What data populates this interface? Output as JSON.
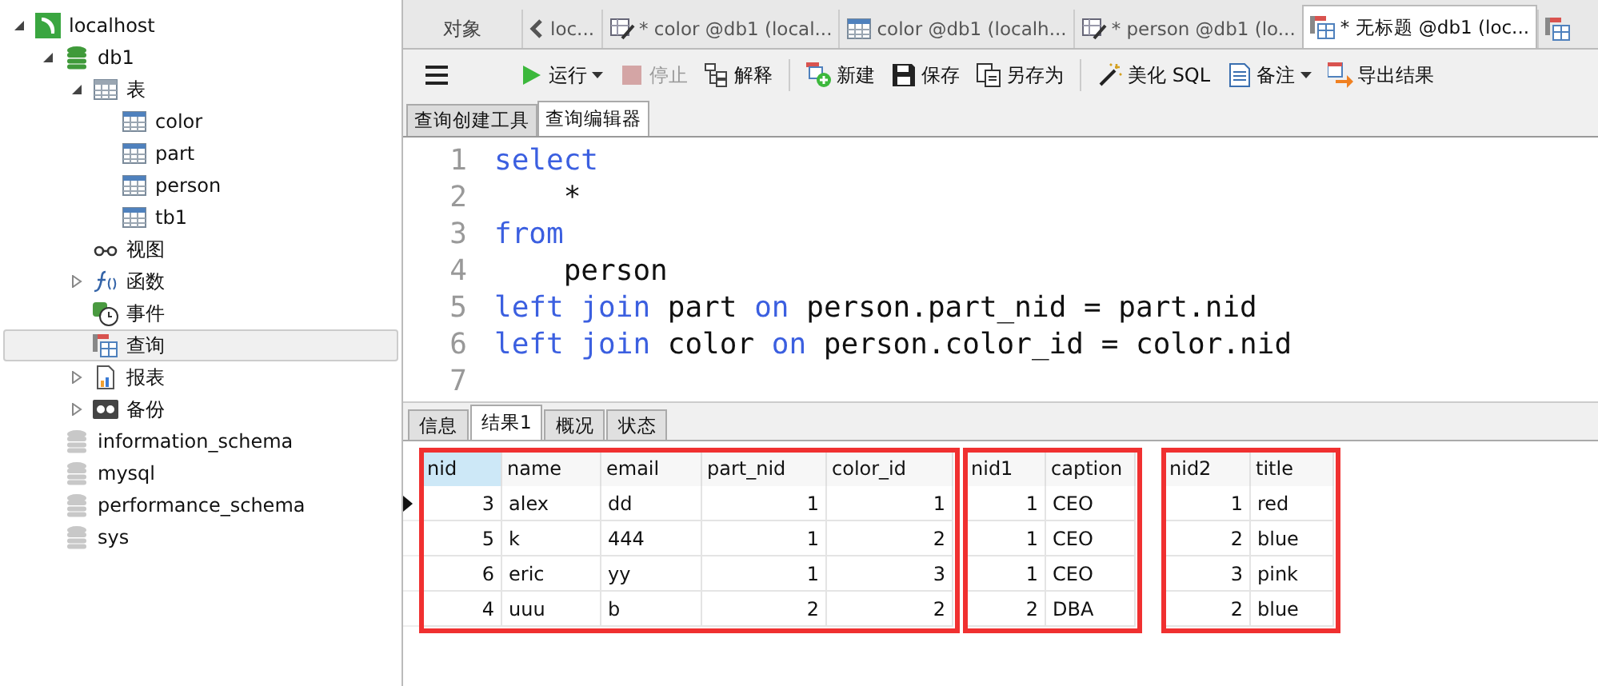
{
  "sidebar": {
    "items": [
      {
        "label": "localhost",
        "kind": "server",
        "expanded": true,
        "selected": false,
        "children": [
          {
            "label": "db1",
            "kind": "database",
            "expanded": true,
            "selected": false,
            "children": [
              {
                "label": "表",
                "kind": "tables",
                "expanded": true,
                "selected": false,
                "children": [
                  {
                    "label": "color",
                    "kind": "table",
                    "selected": false
                  },
                  {
                    "label": "part",
                    "kind": "table",
                    "selected": false
                  },
                  {
                    "label": "person",
                    "kind": "table",
                    "selected": false
                  },
                  {
                    "label": "tb1",
                    "kind": "table",
                    "selected": false
                  }
                ]
              },
              {
                "label": "视图",
                "kind": "view",
                "selected": false
              },
              {
                "label": "函数",
                "kind": "function",
                "expanded": false,
                "selected": false
              },
              {
                "label": "事件",
                "kind": "event",
                "selected": false
              },
              {
                "label": "查询",
                "kind": "query",
                "selected": true
              },
              {
                "label": "报表",
                "kind": "report",
                "expanded": false,
                "selected": false
              },
              {
                "label": "备份",
                "kind": "backup",
                "expanded": false,
                "selected": false
              }
            ]
          },
          {
            "label": "information_schema",
            "kind": "database-closed",
            "selected": false
          },
          {
            "label": "mysql",
            "kind": "database-closed",
            "selected": false
          },
          {
            "label": "performance_schema",
            "kind": "database-closed",
            "selected": false
          },
          {
            "label": "sys",
            "kind": "database-closed",
            "selected": false
          }
        ]
      }
    ]
  },
  "tabs": [
    {
      "label": "loc...",
      "kind": "none",
      "selected": false
    },
    {
      "label": "* color @db1 (local...",
      "kind": "design",
      "selected": false
    },
    {
      "label": "color @db1 (localh...",
      "kind": "table",
      "selected": false
    },
    {
      "label": "* person @db1 (lo...",
      "kind": "design",
      "selected": false
    },
    {
      "label": "* 无标题 @db1 (loc...",
      "kind": "query",
      "selected": true
    },
    {
      "kind": "query",
      "selected": false
    }
  ],
  "objects_tab": "对象",
  "toolbar": {
    "groups": [
      [
        {
          "label": "运行",
          "kind": "run",
          "dropdown": true,
          "disabled": false
        },
        {
          "label": "停止",
          "kind": "stop",
          "dropdown": false,
          "disabled": true
        },
        {
          "label": "解释",
          "kind": "explain",
          "dropdown": false,
          "disabled": false
        }
      ],
      [
        {
          "label": "新建",
          "kind": "new",
          "dropdown": false,
          "disabled": false
        },
        {
          "label": "保存",
          "kind": "save",
          "dropdown": false,
          "disabled": false
        },
        {
          "label": "另存为",
          "kind": "saveas",
          "dropdown": false,
          "disabled": false
        }
      ],
      [
        {
          "label": "美化 SQL",
          "kind": "beautify",
          "dropdown": false,
          "disabled": false
        },
        {
          "label": "备注",
          "kind": "note",
          "dropdown": true,
          "disabled": false
        },
        {
          "label": "导出结果",
          "kind": "export",
          "dropdown": false,
          "disabled": false
        }
      ]
    ]
  },
  "editor_tabs": [
    {
      "label": "查询创建工具",
      "selected": false
    },
    {
      "label": "查询编辑器",
      "selected": true
    }
  ],
  "editor": {
    "lines": [
      {
        "number": "1",
        "tokens": [
          {
            "text": "select",
            "kind": "keyword"
          }
        ]
      },
      {
        "number": "2",
        "tokens": [
          {
            "text": "    *",
            "kind": "plain"
          }
        ]
      },
      {
        "number": "3",
        "tokens": [
          {
            "text": "from",
            "kind": "keyword"
          }
        ]
      },
      {
        "number": "4",
        "tokens": [
          {
            "text": "    person",
            "kind": "plain"
          }
        ]
      },
      {
        "number": "5",
        "tokens": [
          {
            "text": "left join",
            "kind": "keyword"
          },
          {
            "text": " part ",
            "kind": "plain"
          },
          {
            "text": "on",
            "kind": "keyword"
          },
          {
            "text": " person.part_nid = part.nid",
            "kind": "plain"
          }
        ]
      },
      {
        "number": "6",
        "tokens": [
          {
            "text": "left join",
            "kind": "keyword"
          },
          {
            "text": " color ",
            "kind": "plain"
          },
          {
            "text": "on",
            "kind": "keyword"
          },
          {
            "text": " person.color_id = color.nid",
            "kind": "plain"
          }
        ]
      },
      {
        "number": "7"
      }
    ]
  },
  "result_tabs": [
    {
      "label": "信息",
      "selected": false
    },
    {
      "label": "结果1",
      "selected": true
    },
    {
      "label": "概况",
      "selected": false
    },
    {
      "label": "状态",
      "selected": false
    }
  ],
  "grid": {
    "row_markers": [
      {
        "current": true
      },
      {
        "current": false
      },
      {
        "current": false
      },
      {
        "current": false
      }
    ],
    "groups": [
      {
        "highlighted": true,
        "columns": [
          {
            "name": "nid",
            "kind": "number",
            "selected": true
          },
          {
            "name": "name",
            "kind": "text",
            "selected": false
          },
          {
            "name": "email",
            "kind": "text",
            "selected": false
          },
          {
            "name": "part_nid",
            "kind": "number",
            "selected": false
          },
          {
            "name": "color_id",
            "kind": "number",
            "selected": false
          }
        ],
        "rows": [
          [
            "3",
            "alex",
            "dd",
            "1",
            "1"
          ],
          [
            "5",
            "k",
            "444",
            "1",
            "2"
          ],
          [
            "6",
            "eric",
            "yy",
            "1",
            "3"
          ],
          [
            "4",
            "uuu",
            "b",
            "2",
            "2"
          ]
        ]
      },
      {
        "highlighted": true,
        "columns": [
          {
            "name": "nid1",
            "kind": "number",
            "selected": false
          },
          {
            "name": "caption",
            "kind": "text",
            "selected": false
          }
        ],
        "rows": [
          [
            "1",
            "CEO"
          ],
          [
            "1",
            "CEO"
          ],
          [
            "1",
            "CEO"
          ],
          [
            "2",
            "DBA"
          ]
        ]
      },
      {
        "highlighted": true,
        "columns": [
          {
            "name": "nid2",
            "kind": "number",
            "selected": false
          },
          {
            "name": "title",
            "kind": "text",
            "selected": false
          }
        ],
        "rows": [
          [
            "1",
            "red"
          ],
          [
            "2",
            "blue"
          ],
          [
            "3",
            "pink"
          ],
          [
            "2",
            "blue"
          ]
        ]
      }
    ]
  }
}
